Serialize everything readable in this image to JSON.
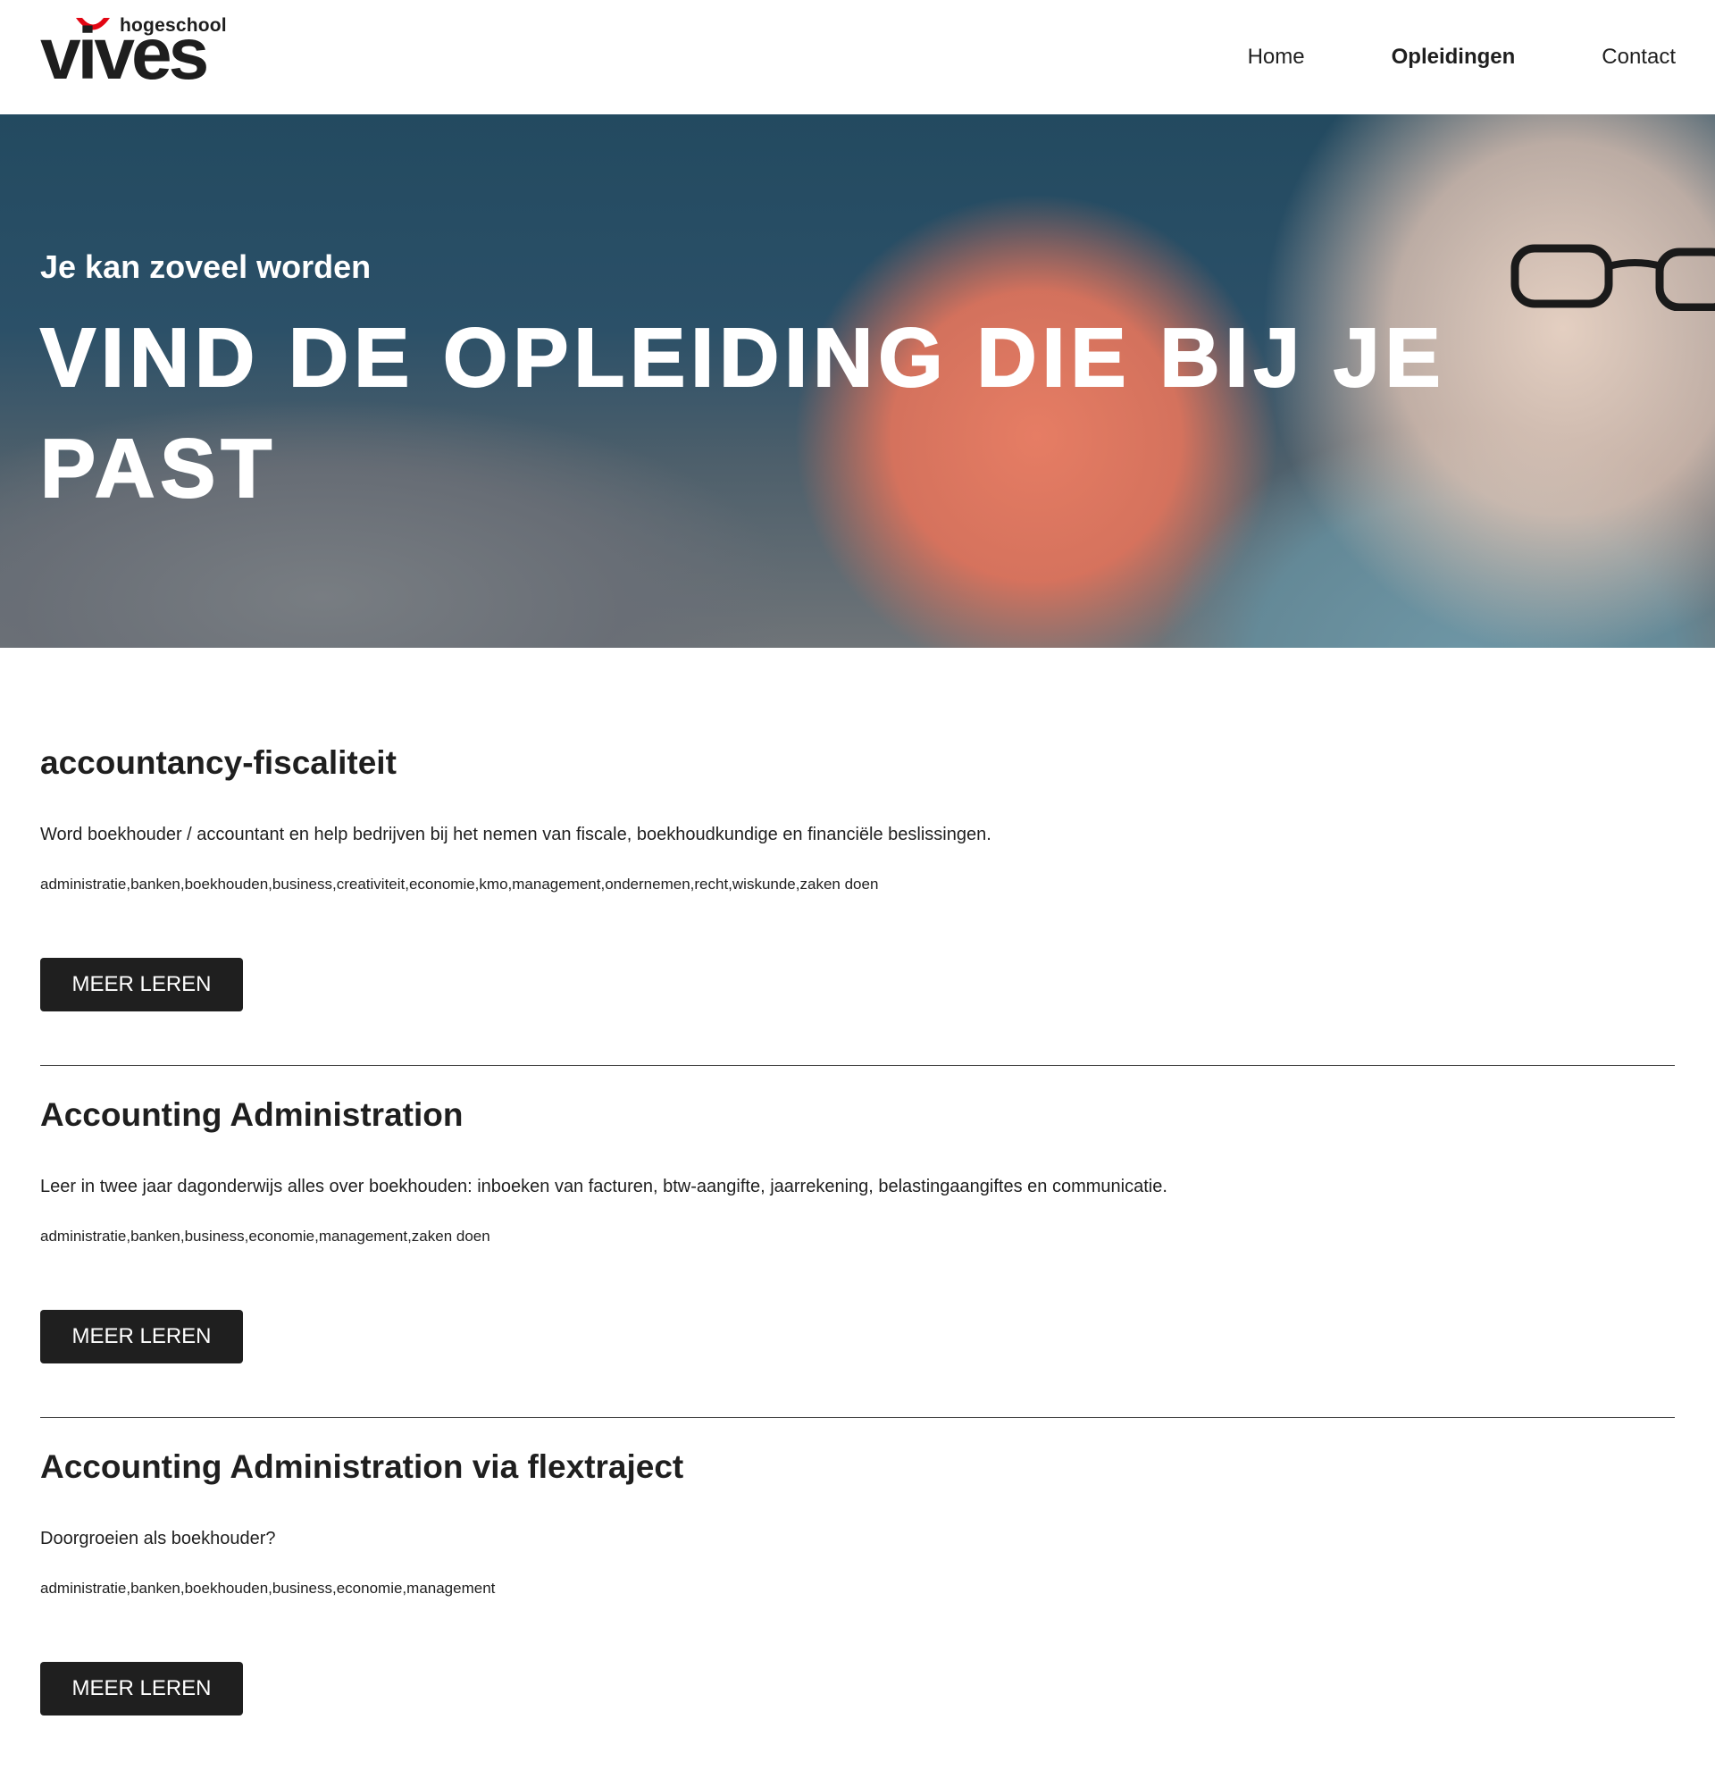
{
  "header": {
    "logo": {
      "small_text": "hogeschool",
      "big_text": "vives",
      "accent_color": "#e30613"
    },
    "nav": [
      {
        "label": "Home",
        "active": false
      },
      {
        "label": "Opleidingen",
        "active": true
      },
      {
        "label": "Contact",
        "active": false
      }
    ]
  },
  "hero": {
    "subtitle": "Je kan zoveel worden",
    "title": "VIND DE OPLEIDING DIE BIJ JE PAST"
  },
  "courses": [
    {
      "title": "accountancy-fiscaliteit",
      "description": "Word boekhouder / accountant en help bedrijven bij het nemen van fiscale, boekhoudkundige en financiële beslissingen.",
      "tags": "administratie,banken,boekhouden,business,creativiteit,economie,kmo,management,ondernemen,recht,wiskunde,zaken doen",
      "button_label": "MEER LEREN"
    },
    {
      "title": "Accounting Administration",
      "description": "Leer in twee jaar dagonderwijs alles over boekhouden: inboeken van facturen, btw-aangifte, jaarrekening, belastingaangiftes en communicatie.",
      "tags": "administratie,banken,business,economie,management,zaken doen",
      "button_label": "MEER LEREN"
    },
    {
      "title": "Accounting Administration via flextraject",
      "description": "Doorgroeien als boekhouder?",
      "tags": "administratie,banken,boekhouden,business,economie,management",
      "button_label": "MEER LEREN"
    }
  ],
  "colors": {
    "button_bg": "#1f1f1f",
    "text": "#1f1f1f",
    "background": "#ffffff"
  }
}
